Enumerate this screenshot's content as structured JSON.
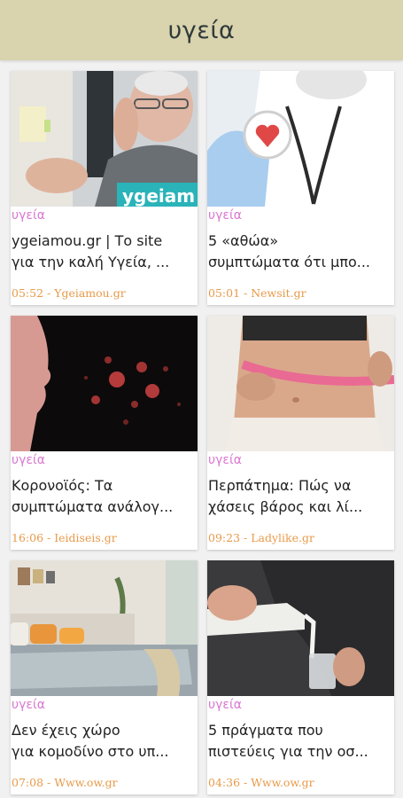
{
  "header": {
    "title": "υγεία"
  },
  "colors": {
    "header_bg": "#d9d3ae",
    "category": "#d978d1",
    "meta": "#e89a4a"
  },
  "cards": [
    {
      "category": "υγεία",
      "title_line1": "ygeiamou.gr | Το site",
      "title_line2": "για την καλή Υγεία, ...",
      "meta": "05:52 - Ygeiamou.gr",
      "watermark": "ygeiam"
    },
    {
      "category": "υγεία",
      "title_line1": "5 «αθώα»",
      "title_line2": "συμπτώματα ότι μπο...",
      "meta": "05:01 - Newsit.gr"
    },
    {
      "category": "υγεία",
      "title_line1": "Κορονοϊός: Τα",
      "title_line2": "συμπτώματα ανάλογ...",
      "meta": "16:06 - Ieidiseis.gr"
    },
    {
      "category": "υγεία",
      "title_line1": "Περπάτημα: Πώς να",
      "title_line2": "χάσεις βάρος και λί...",
      "meta": "09:23 - Ladylike.gr"
    },
    {
      "category": "υγεία",
      "title_line1": "Δεν έχεις χώρο",
      "title_line2": "για κομοδίνο στο υπ...",
      "meta": "07:08 - Www.ow.gr"
    },
    {
      "category": "υγεία",
      "title_line1": "5 πράγματα που",
      "title_line2": "πιστεύεις για την οσ...",
      "meta": "04:36 - Www.ow.gr"
    }
  ]
}
